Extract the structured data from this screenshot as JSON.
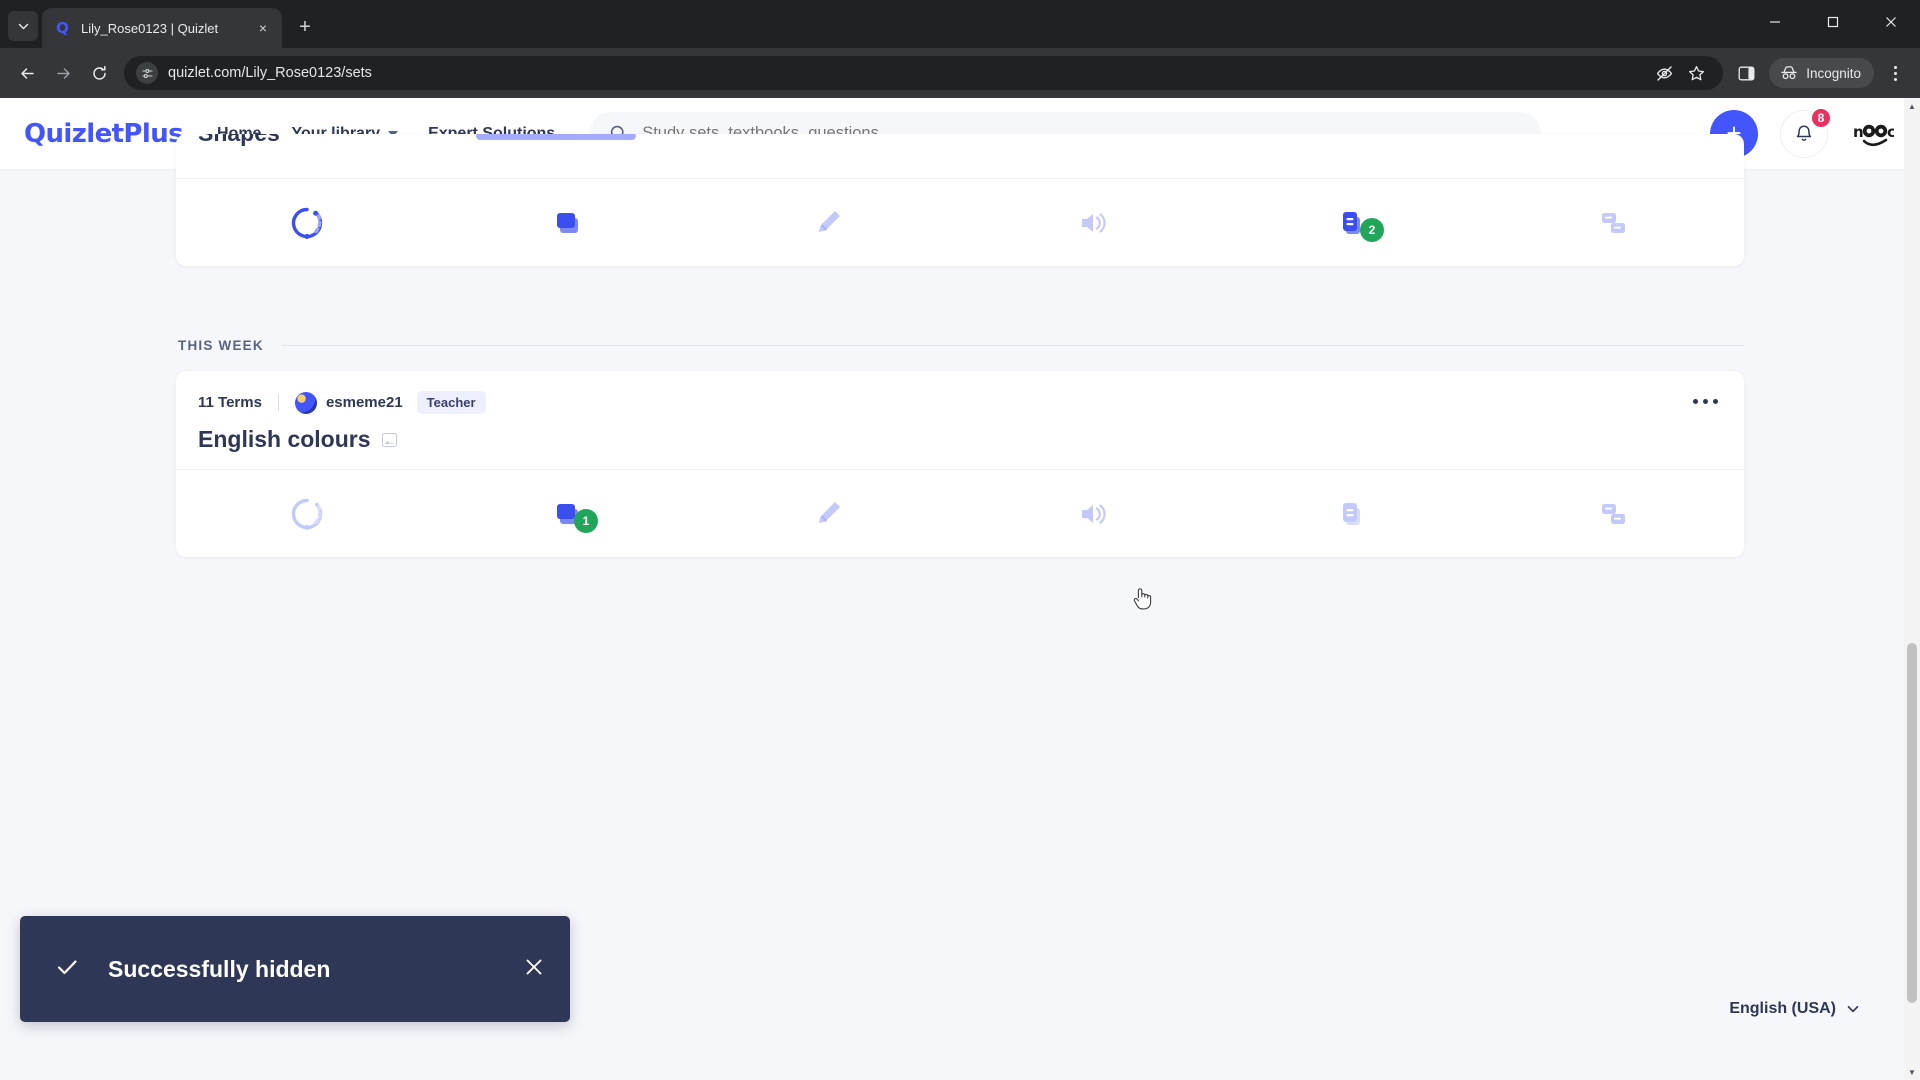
{
  "browser": {
    "tab": {
      "title": "Lily_Rose0123 | Quizlet",
      "favicon": "quizlet-q-icon",
      "close": "×"
    },
    "new_tab_label": "+",
    "tab_list_icon": "chevron-down-icon",
    "window": {
      "minimize": "—",
      "maximize": "☐",
      "close": "✕"
    },
    "nav": {
      "back": "←",
      "forward": "→",
      "reload": "↻"
    },
    "url": "quizlet.com/Lily_Rose0123/sets",
    "site_info_icon": "page-settings-icon",
    "toolbar_icons": [
      "eye-slash-icon",
      "star-icon",
      "side-panel-icon"
    ],
    "incognito_label": "Incognito",
    "menu_icon": "three-dot-menu-icon"
  },
  "navbar": {
    "logo": "QuizletPlus",
    "links": [
      {
        "label": "Home",
        "has_chevron": false
      },
      {
        "label": "Your library",
        "has_chevron": true
      },
      {
        "label": "Expert Solutions",
        "has_chevron": false
      }
    ],
    "search": {
      "placeholder": "Study sets, textbooks, questions",
      "value": "",
      "icon": "search-icon"
    },
    "create_button": "+",
    "notifications": {
      "icon": "bell-icon",
      "count": "8"
    },
    "avatar": {
      "alt": "nOOc"
    }
  },
  "sections": [
    {
      "clipped": true,
      "title": "Shapes",
      "actions": [
        {
          "name": "learn",
          "icon": "learn-progress-icon",
          "active": true,
          "badge": null
        },
        {
          "name": "flashcards",
          "icon": "flashcards-icon",
          "active": true,
          "badge": null
        },
        {
          "name": "write",
          "icon": "write-pen-icon",
          "active": false,
          "badge": null
        },
        {
          "name": "spell",
          "icon": "speaker-icon",
          "active": false,
          "badge": null
        },
        {
          "name": "test",
          "icon": "test-paper-icon",
          "active": true,
          "badge": "2"
        },
        {
          "name": "match",
          "icon": "match-cards-icon",
          "active": false,
          "badge": null
        }
      ]
    },
    {
      "clipped": false,
      "heading": "THIS WEEK",
      "set": {
        "terms": "11 Terms",
        "author": "esmeme21",
        "author_badge": "Teacher",
        "title": "English colours",
        "has_image_chip": true,
        "overflow_icon": "overflow-menu-icon"
      },
      "actions": [
        {
          "name": "learn",
          "icon": "learn-progress-icon",
          "active": false,
          "badge": null
        },
        {
          "name": "flashcards",
          "icon": "flashcards-icon",
          "active": true,
          "badge": "1"
        },
        {
          "name": "write",
          "icon": "write-pen-icon",
          "active": false,
          "badge": null
        },
        {
          "name": "spell",
          "icon": "speaker-icon",
          "active": false,
          "badge": null
        },
        {
          "name": "test",
          "icon": "test-paper-icon",
          "active": false,
          "badge": null
        },
        {
          "name": "match",
          "icon": "match-cards-icon",
          "active": false,
          "badge": null
        }
      ]
    }
  ],
  "toast": {
    "icon": "check-icon",
    "message": "Successfully hidden",
    "close": "✕"
  },
  "footer": {
    "language": "English (USA)",
    "chevron": "chevron-down-icon"
  },
  "colors": {
    "brand": "#4255ff",
    "badge_green": "#23a559",
    "badge_red": "#e8315e",
    "text_dark": "#2e3856",
    "page_bg": "#f6f7fb",
    "toast_bg": "#2e3856"
  }
}
